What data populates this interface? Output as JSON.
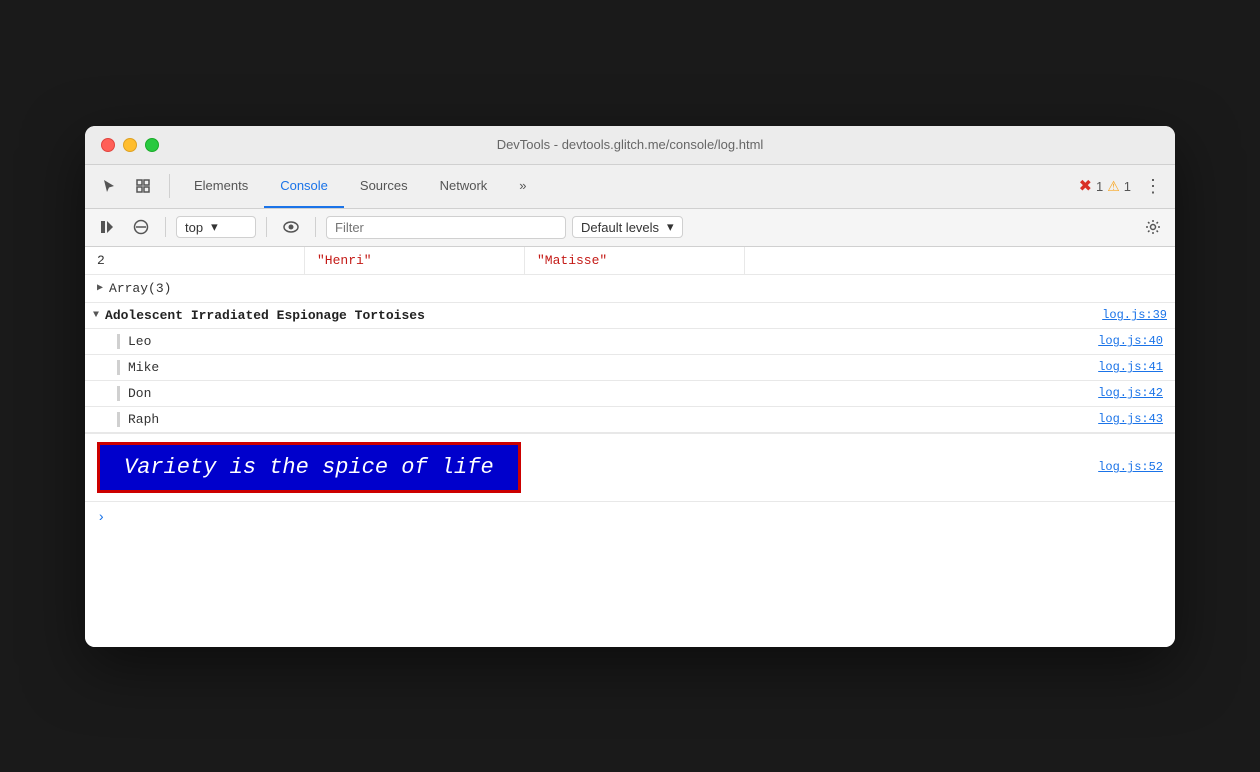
{
  "window": {
    "title": "DevTools - devtools.glitch.me/console/log.html"
  },
  "tabs": {
    "items": [
      {
        "id": "elements",
        "label": "Elements",
        "active": false
      },
      {
        "id": "console",
        "label": "Console",
        "active": true
      },
      {
        "id": "sources",
        "label": "Sources",
        "active": false
      },
      {
        "id": "network",
        "label": "Network",
        "active": false
      }
    ],
    "more_label": "»"
  },
  "badges": {
    "errors": {
      "icon": "✖",
      "count": "1"
    },
    "warnings": {
      "icon": "⚠",
      "count": "1"
    }
  },
  "toolbar": {
    "context_value": "top",
    "filter_placeholder": "Filter",
    "levels_label": "Default levels"
  },
  "console_output": {
    "table_row": {
      "col1": "2",
      "col2": "\"Henri\"",
      "col3": "\"Matisse\""
    },
    "array_row": {
      "label": "Array(3)"
    },
    "group": {
      "label": "Adolescent Irradiated Espionage Tortoises",
      "source": "log.js:39",
      "entries": [
        {
          "label": "Leo",
          "source": "log.js:40"
        },
        {
          "label": "Mike",
          "source": "log.js:41"
        },
        {
          "label": "Don",
          "source": "log.js:42"
        },
        {
          "label": "Raph",
          "source": "log.js:43"
        }
      ]
    },
    "styled_row": {
      "text": "Variety is the spice of life",
      "source": "log.js:52"
    }
  },
  "icons": {
    "cursor": "⬡",
    "inspect": "⬜",
    "play": "▶",
    "clear": "🚫",
    "eye": "👁",
    "chevron_down": "▾",
    "gear": "⚙",
    "more": "»",
    "menu": "⋮",
    "expand_closed": "▶",
    "expand_open": "▼"
  },
  "colors": {
    "active_tab": "#1a73e8",
    "string_red": "#c41a16",
    "link_blue": "#1a73e8",
    "styled_bg": "#0000cc",
    "styled_border": "#cc0000",
    "styled_text": "#ffffff"
  }
}
